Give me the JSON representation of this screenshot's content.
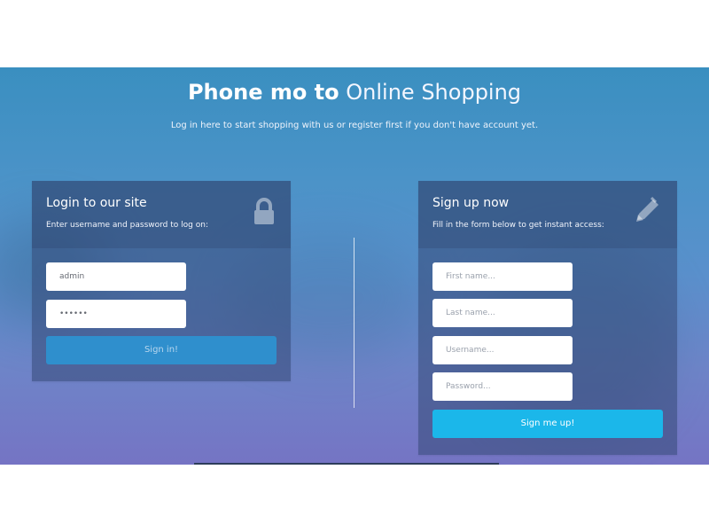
{
  "header": {
    "title_strong": "Phone mo to",
    "title_light": "Online Shopping",
    "subtitle": "Log in here to start shopping with us or register first if you don't have account yet."
  },
  "login": {
    "title": "Login to our site",
    "description": "Enter username and password to log on:",
    "icon": "lock-icon",
    "username_value": "admin",
    "password_value": "••••••",
    "submit_label": "Sign in!"
  },
  "signup": {
    "title": "Sign up now",
    "description": "Fill in the form below to get instant access:",
    "icon": "pencil-icon",
    "first_name_placeholder": "First name...",
    "last_name_placeholder": "Last name...",
    "username_placeholder": "Username...",
    "password_placeholder": "Password...",
    "submit_label": "Sign me up!"
  },
  "colors": {
    "hero_top": "#3a8fc0",
    "hero_bottom": "#7574c4",
    "signin_button": "#2f8fcd",
    "signup_button": "#1bb7ea",
    "card_overlay": "#354976"
  }
}
